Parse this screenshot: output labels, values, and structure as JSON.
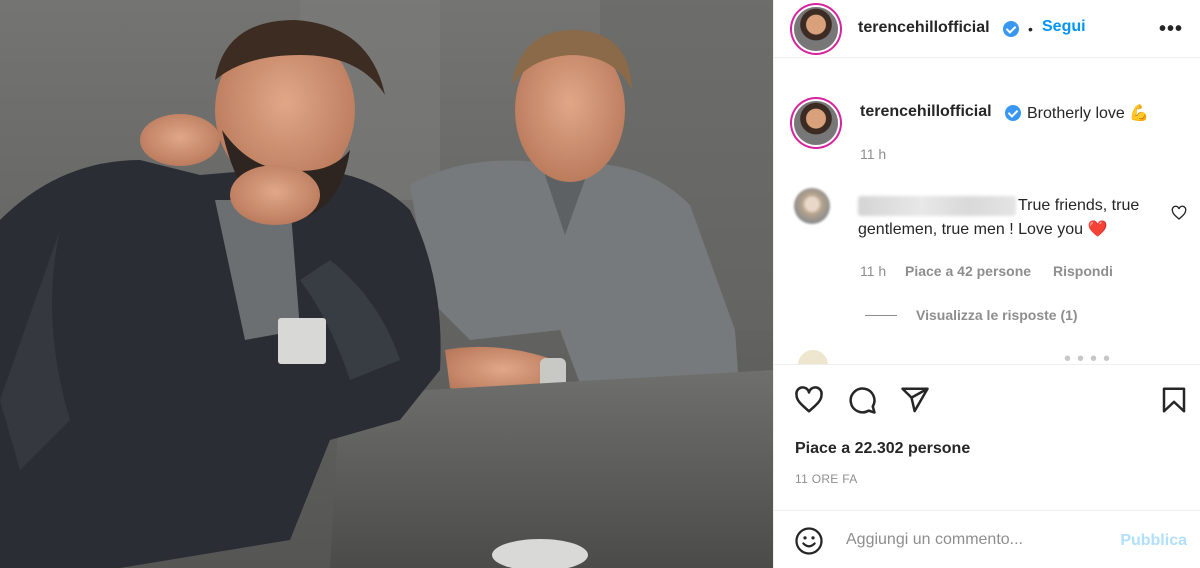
{
  "post": {
    "image_alt": "Two men seated at a table, one bearded with arm around the other",
    "colors": {
      "accent": "#0095f6",
      "verified": "#3897f0",
      "muted": "#8e8e8e",
      "text": "#262626",
      "heart": "#ed4956"
    }
  },
  "header": {
    "username": "terencehillofficial",
    "separator": "•",
    "follow_label": "Segui",
    "more_label": "•••",
    "avatar_icon": "profile-avatar-icon",
    "verified_icon": "verified-badge-icon"
  },
  "caption": {
    "username": "terencehillofficial",
    "text": "Brotherly love 💪",
    "time": "11 h"
  },
  "comments": [
    {
      "username_blurred": true,
      "text": "True friends, true gentlemen, true men ! Love you ❤️",
      "time": "11 h",
      "likes": "Piace a 42 persone",
      "reply_label": "Rispondi",
      "view_replies": "Visualizza le risposte (1)"
    }
  ],
  "actions": {
    "like_icon": "heart-icon",
    "comment_icon": "comment-icon",
    "share_icon": "share-icon",
    "save_icon": "bookmark-icon",
    "likes_text": "Piace a 22.302 persone",
    "time_ago": "11 ORE FA"
  },
  "add_comment": {
    "emoji_icon": "emoji-icon",
    "placeholder": "Aggiungi un commento...",
    "publish_label": "Pubblica"
  }
}
